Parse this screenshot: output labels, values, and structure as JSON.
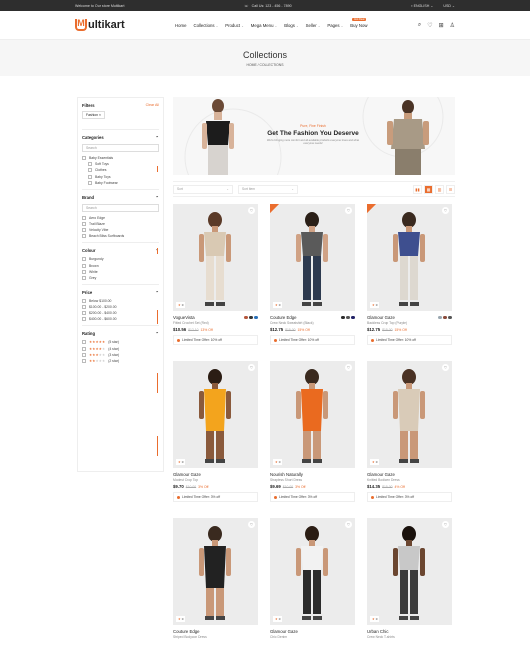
{
  "topbar": {
    "welcome": "Welcome to Our store Multikart",
    "call": "Call Us: 123 - 456 - 7890",
    "language": "ENGLISH",
    "currency": "USD"
  },
  "header": {
    "logo_rest": "ultikart",
    "logo_mark": "M",
    "nav": [
      "Home",
      "Collections",
      "Product",
      "Mega Menu",
      "Blogs",
      "Seller",
      "Pages",
      "Buy Now"
    ],
    "buy_badge": "Hot Deal"
  },
  "page": {
    "title": "Collections",
    "breadcrumb": "HOME / COLLECTIONS"
  },
  "filters": {
    "title": "Filters",
    "clear": "Clear All",
    "chip": "Fashion ×",
    "categories": {
      "title": "Categories",
      "search": "Search",
      "items": [
        "Baby Essentials",
        "Soft Toys",
        "Clothes",
        "Baby Toys",
        "Baby Footwear"
      ]
    },
    "brand": {
      "title": "Brand",
      "search": "Search",
      "items": [
        "Aero Edge",
        "Trail Blaze",
        "Velocity Vibe",
        "Beach Bliss Surfboards"
      ]
    },
    "colour": {
      "title": "Colour",
      "items": [
        "Burgundy",
        "Brown",
        "White",
        "Grey"
      ]
    },
    "price": {
      "title": "Price",
      "items": [
        "Below $100.00",
        "$100.00 - $200.00",
        "$200.00 - $400.00",
        "$400.00 - $600.00"
      ]
    },
    "rating": {
      "title": "Rating",
      "items": [
        {
          "stars": 5,
          "label": "(5 star)"
        },
        {
          "stars": 4,
          "label": "(4 star)"
        },
        {
          "stars": 3,
          "label": "(3 star)"
        },
        {
          "stars": 2,
          "label": "(2 star)"
        }
      ]
    }
  },
  "banner": {
    "tag": "Pure, Fine Finish",
    "headline": "Get The Fashion You Deserve",
    "sub": "We're bringing more comfort and all available products everyone loves and what everyone needs!"
  },
  "toolbar": {
    "sort": "Sort",
    "sort_items": "Sort Item"
  },
  "products": [
    {
      "brand": "VogueVista",
      "name": "Fitted Crochet Set (Red)",
      "price": "$10.56",
      "old": "$12.10",
      "off": "13% Off",
      "offer": "Limited Time Offer: 10% off",
      "rating": "0",
      "colors": [
        "#b4553b",
        "#333333",
        "#2a70b8"
      ],
      "ribbon": false
    },
    {
      "brand": "Couture Edge",
      "name": "Crew Neck Sweatshirt (Black)",
      "price": "$12.75",
      "old": "$15.00",
      "off": "15% Off",
      "offer": "Limited Time Offer: 10% off",
      "rating": "0",
      "colors": [
        "#2b2b2b",
        "#555555",
        "#222266"
      ],
      "ribbon": true
    },
    {
      "brand": "Glamour Gaze",
      "name": "Backless Crop Top (Purple)",
      "price": "$12.75",
      "old": "$15.00",
      "off": "15% Off",
      "offer": "Limited Time Offer: 10% off",
      "rating": "0",
      "colors": [
        "#9aa7b0",
        "#8a4a3a",
        "#555555"
      ],
      "ribbon": true
    },
    {
      "brand": "Glamour Gaze",
      "name": "Modest Crop Top",
      "price": "$9.70",
      "old": "$10.00",
      "off": "3% Off",
      "offer": "Limited Time Offer: 3% off",
      "rating": "0",
      "colors": [],
      "ribbon": false
    },
    {
      "brand": "Nourish Naturally",
      "name": "Strapless Short Dress",
      "price": "$9.69",
      "old": "$10.00",
      "off": "3% Off",
      "offer": "Limited Time Offer: 3% off",
      "rating": "0",
      "colors": [],
      "ribbon": false
    },
    {
      "brand": "Glamour Gaze",
      "name": "Knitted Bodicen Dress",
      "price": "$14.35",
      "old": "$15.00",
      "off": "4% Off",
      "offer": "Limited Time Offer: 3% off",
      "rating": "0",
      "colors": [],
      "ribbon": false
    },
    {
      "brand": "Couture Edge",
      "name": "Striped Bodycon Dress",
      "price": "",
      "old": "",
      "off": "",
      "offer": "",
      "rating": "0",
      "colors": [],
      "ribbon": false
    },
    {
      "brand": "Glamour Gaze",
      "name": "Chic Denim",
      "price": "",
      "old": "",
      "off": "",
      "offer": "",
      "rating": "0",
      "colors": [],
      "ribbon": false
    },
    {
      "brand": "Urban Chic",
      "name": "Crew Neck T-shirts",
      "price": "",
      "old": "",
      "off": "",
      "offer": "",
      "rating": "0",
      "colors": [],
      "ribbon": false
    }
  ],
  "colors": {
    "accent": "#ea6d2e",
    "topbar": "#2e2e2e"
  }
}
